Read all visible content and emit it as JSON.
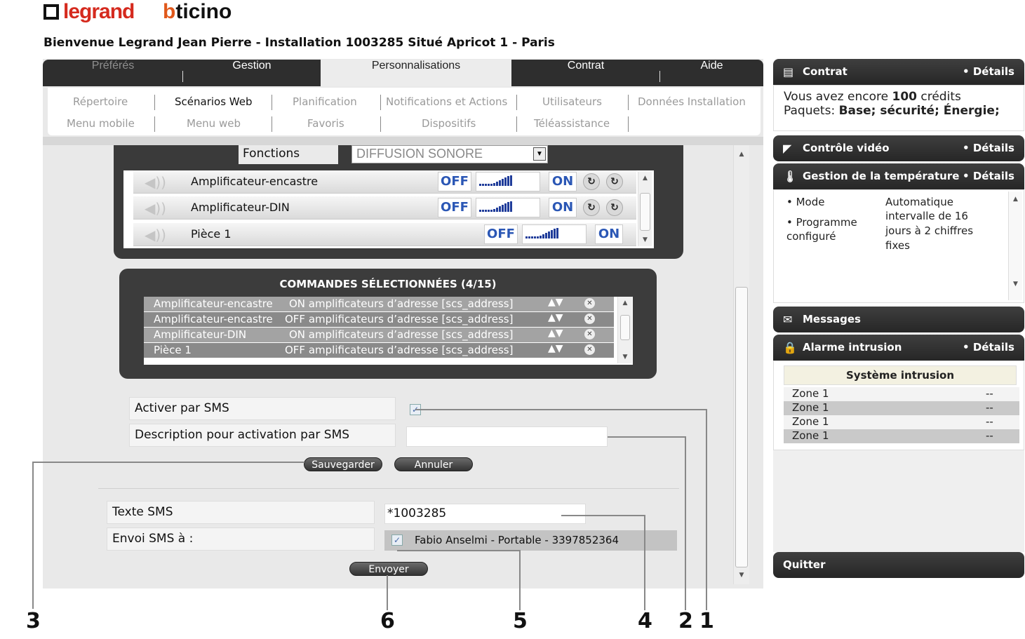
{
  "header": {
    "logo_legrand": "legrand",
    "logo_bticino": "bticino",
    "welcome": "Bienvenue Legrand Jean Pierre - Installation 1003285 Situé Apricot 1 - Paris"
  },
  "tabs": [
    {
      "label": "Préférés",
      "state": "dim"
    },
    {
      "label": "Gestion",
      "state": "normal"
    },
    {
      "label": "Personnalisations",
      "state": "active"
    },
    {
      "label": "Contrat",
      "state": "normal"
    },
    {
      "label": "Aide",
      "state": "normal"
    }
  ],
  "subnav": {
    "row1": [
      "Répertoire",
      "Scénarios Web",
      "Planification",
      "Notifications et Actions",
      "Utilisateurs",
      "Données Installation"
    ],
    "row2": [
      "Menu mobile",
      "Menu web",
      "Favoris",
      "Dispositifs",
      "Téléassistance"
    ],
    "active": "Scénarios Web"
  },
  "fonctions": {
    "label": "Fonctions",
    "selected": "DIFFUSION SONORE",
    "devices": [
      {
        "name": "Amplificateur-encastre",
        "off": "OFF",
        "on": "ON",
        "r1": "↻",
        "r2": "↻"
      },
      {
        "name": "Amplificateur-DIN",
        "off": "OFF",
        "on": "ON",
        "r1": "↻",
        "r2": "↻"
      },
      {
        "name": "Pièce 1",
        "off": "OFF",
        "on": "ON"
      }
    ]
  },
  "commandes": {
    "title": "COMMANDES SÉLECTIONNÉES (4/15)",
    "rows": [
      {
        "device": "Amplificateur-encastre",
        "command": "ON amplificateurs d’adresse [scs_address]",
        "arrows": "▲▼",
        "remove": "✕"
      },
      {
        "device": "Amplificateur-encastre",
        "command": "OFF amplificateurs d’adresse  [scs_address]",
        "arrows": "▲▼",
        "remove": "✕"
      },
      {
        "device": "Amplificateur-DIN",
        "command": "ON amplificateurs d’adresse [scs_address]",
        "arrows": "▲▼",
        "remove": "✕"
      },
      {
        "device": "Pièce 1",
        "command": "OFF amplificateurs d’adresse [scs_address]",
        "arrows": "▲▼",
        "remove": "✕"
      }
    ]
  },
  "sms_activation": {
    "activer_label": "Activer par SMS",
    "activer_checked": "✓",
    "description_label": "Description pour activation par SMS",
    "description_value": "",
    "save": "Sauvegarder",
    "cancel": "Annuler"
  },
  "sms_send": {
    "texte_label": "Texte SMS",
    "texte_value": "*1003285",
    "envoi_label": "Envoi SMS à :",
    "contact_checked": "✓",
    "contact": "Fabio Anselmi - Portable - 3397852364",
    "send": "Envoyer"
  },
  "sidebar": {
    "contrat": {
      "title": "Contrat",
      "details": "• Détails",
      "line1_pre": "Vous avez encore ",
      "credits": "100",
      "line1_post": " crédits",
      "line2_pre": "Paquets: ",
      "packages": "Base; sécurité; Énergie;"
    },
    "video": {
      "title": "Contrôle vidéo",
      "details": "• Détails"
    },
    "temperature": {
      "title": "Gestion de la température",
      "details": "• Détails",
      "mode_label": "• Mode",
      "mode_value": "Automatique",
      "prog_label_1": "• Programme",
      "prog_label_2": "configuré",
      "prog_value_1": "intervalle de 16",
      "prog_value_2": "jours à 2 chiffres",
      "prog_value_3": "fixes"
    },
    "messages": {
      "title": "Messages"
    },
    "alarme": {
      "title": "Alarme intrusion",
      "details": "• Détails",
      "system": "Système intrusion",
      "zones": [
        {
          "name": "Zone 1",
          "value": "--"
        },
        {
          "name": "Zone 1",
          "value": "--"
        },
        {
          "name": "Zone 1",
          "value": "--"
        },
        {
          "name": "Zone 1",
          "value": "--"
        }
      ]
    },
    "quit": "Quitter"
  },
  "callouts": [
    "3",
    "6",
    "5",
    "4",
    "2",
    "1"
  ]
}
